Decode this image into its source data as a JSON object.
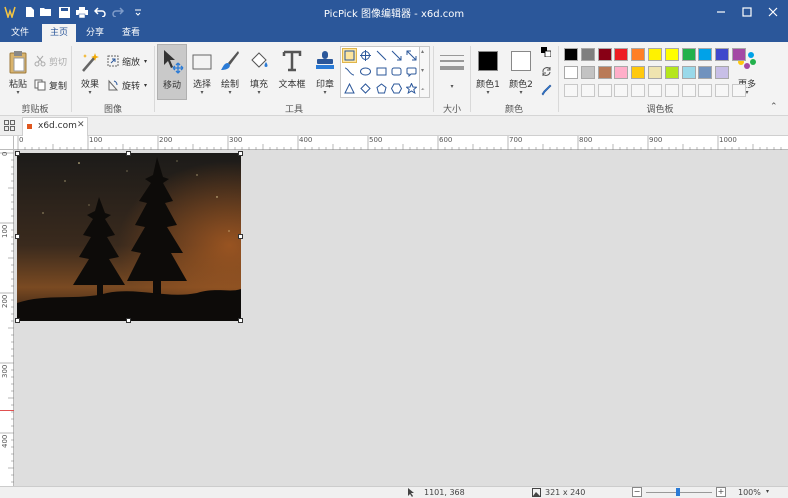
{
  "window": {
    "title": "PicPick 图像编辑器 - x6d.com"
  },
  "menu": {
    "tabs": [
      {
        "label": "文件"
      },
      {
        "label": "主页"
      },
      {
        "label": "分享"
      },
      {
        "label": "查看"
      }
    ]
  },
  "ribbon": {
    "clipboard": {
      "group_label": "剪贴板",
      "paste": "粘贴",
      "cut": "剪切",
      "copy": "复制"
    },
    "image": {
      "group_label": "图像",
      "effects": "效果",
      "resize": "缩放",
      "rotate": "旋转"
    },
    "tools": {
      "group_label": "工具",
      "move": "移动",
      "select": "选择",
      "draw": "绘制",
      "fill": "填充",
      "textbox": "文本框",
      "stamp": "印章"
    },
    "size": {
      "group_label": "大小"
    },
    "colors": {
      "group_label": "颜色",
      "color1": "颜色1",
      "color2": "颜色2"
    },
    "palette": {
      "group_label": "调色板",
      "more": "更多",
      "row1": [
        "#000000",
        "#7f7f7f",
        "#880015",
        "#ed1c24",
        "#ff7f27",
        "#fff200",
        "#ffff00",
        "#22b14c",
        "#00a2e8",
        "#3f48cc",
        "#a349a4"
      ],
      "row2": [
        "#ffffff",
        "#c3c3c3",
        "#b97a57",
        "#ffaec9",
        "#ffc90e",
        "#efe4b0",
        "#b5e61d",
        "#99d9ea",
        "#7092be",
        "#c8bfe7"
      ]
    }
  },
  "document": {
    "tab_label": "x6d.com"
  },
  "ruler": {
    "h_labels": [
      "0",
      "100",
      "200",
      "300",
      "400",
      "500",
      "600",
      "700",
      "800",
      "900",
      "1000"
    ],
    "v_labels": [
      "0",
      "100",
      "200",
      "300",
      "400"
    ]
  },
  "status": {
    "cursor_pos": "1101, 368",
    "image_size": "321 x 240",
    "zoom": "100%"
  }
}
